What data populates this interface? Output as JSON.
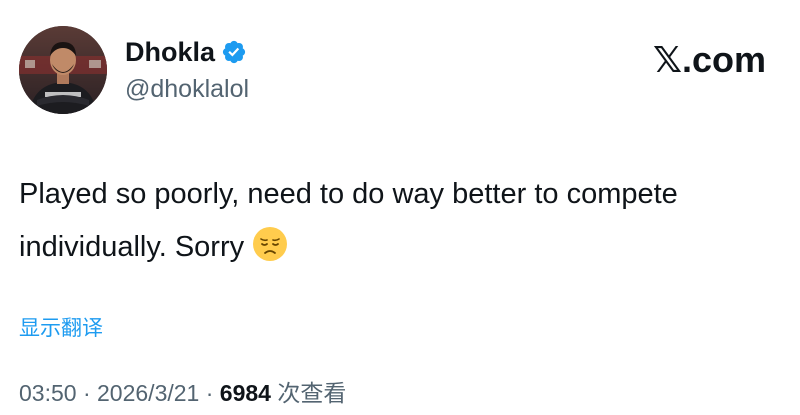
{
  "author": {
    "display_name": "Dhokla",
    "handle": "@dhoklalol",
    "verified": true,
    "verified_color": "#1d9bf0",
    "avatar_icon": "player-avatar-photo"
  },
  "source_logo": "𝕏.com",
  "tweet": {
    "text": "Played so poorly, need to do way better to compete individually. Sorry",
    "emoji": "disappointed-face-icon"
  },
  "translate_label": "显示翻译",
  "meta": {
    "time": "03:50",
    "separator": "·",
    "date": "2026/3/21",
    "views_count": "6984",
    "views_label": "次查看"
  },
  "colors": {
    "link": "#1d9bf0",
    "secondary_text": "#536471",
    "primary_text": "#0f1419"
  }
}
